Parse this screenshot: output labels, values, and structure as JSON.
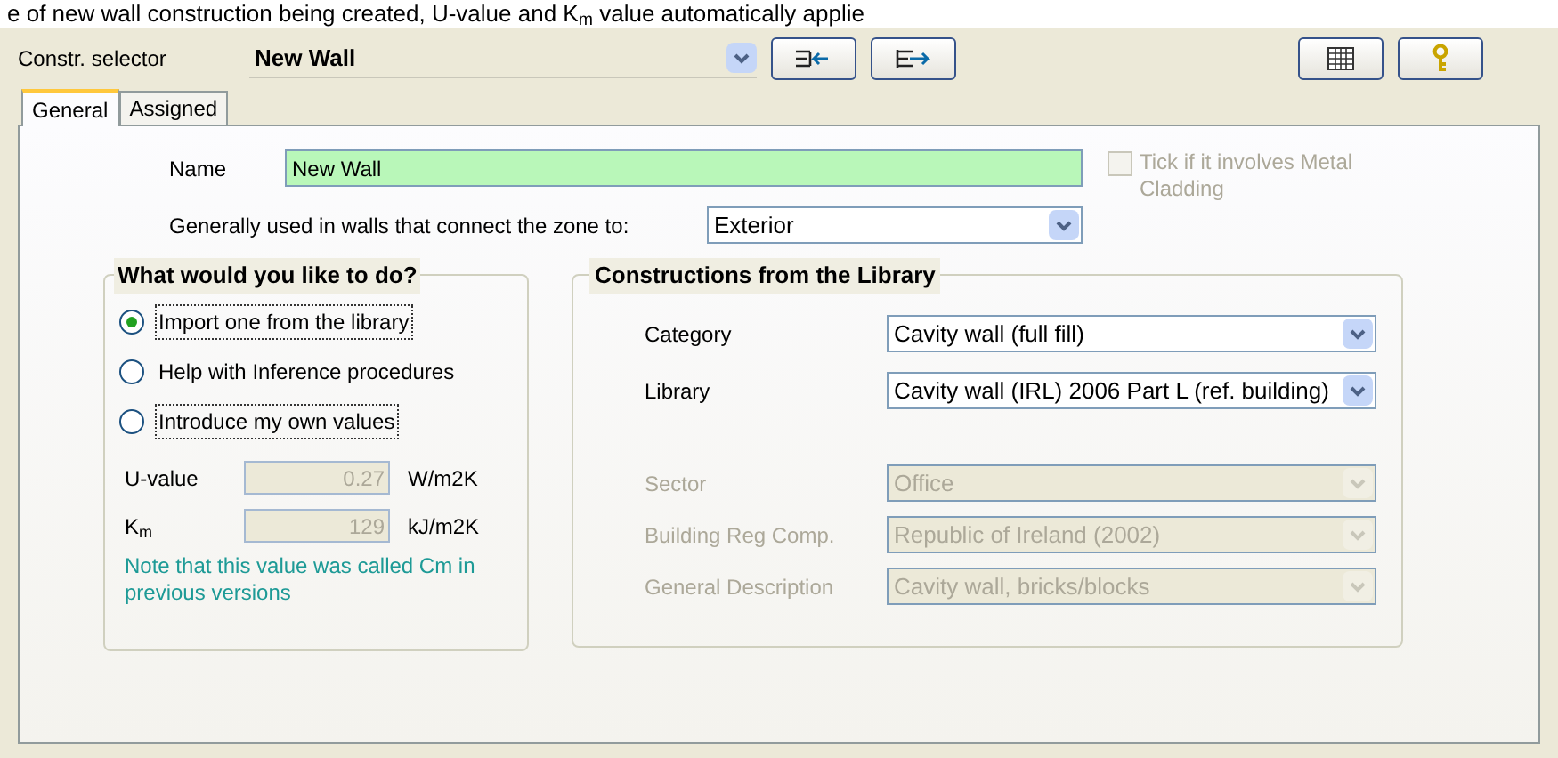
{
  "caption": "e of new wall construction being created, U-value and K$_{m}$ value automatically applie",
  "toolbar": {
    "label": "Constr. selector",
    "selector_value": "New Wall"
  },
  "tabs": [
    {
      "label": "General",
      "selected": true
    },
    {
      "label": "Assigned",
      "selected": false
    }
  ],
  "name_field": {
    "label": "Name",
    "value": "New Wall"
  },
  "metal_cladding": {
    "label": "Tick if it involves Metal Cladding",
    "checked": false,
    "disabled": true
  },
  "connects_to": {
    "label": "Generally used in walls that connect the zone to:",
    "value": "Exterior"
  },
  "what_to_do": {
    "title": "What would you like to do?",
    "options": [
      {
        "label": "Import one from the library",
        "selected": true,
        "focused": true
      },
      {
        "label": "Help with Inference procedures",
        "selected": false,
        "focused": false
      },
      {
        "label": "Introduce my own values",
        "selected": false,
        "focused": true
      }
    ],
    "values": [
      {
        "label": "U-value",
        "value": "0.27",
        "unit": "W/m2K"
      },
      {
        "label": "Κ$_{m}$",
        "value": "129",
        "unit": "kJ/m2K"
      }
    ],
    "note": "Note that this value was called Cm in previous versions"
  },
  "library": {
    "title": "Constructions from the Library",
    "fields": [
      {
        "label": "Category",
        "value": "Cavity wall (full fill)",
        "disabled": false
      },
      {
        "label": "Library",
        "value": "Cavity wall (IRL) 2006 Part L (ref. building)",
        "disabled": false
      },
      {
        "label": "Sector",
        "value": "Office",
        "disabled": true
      },
      {
        "label": "Building Reg Comp.",
        "value": "Republic of Ireland (2002)",
        "disabled": true
      },
      {
        "label": "General Description",
        "value": "Cavity wall, bricks/blocks",
        "disabled": true
      }
    ]
  }
}
